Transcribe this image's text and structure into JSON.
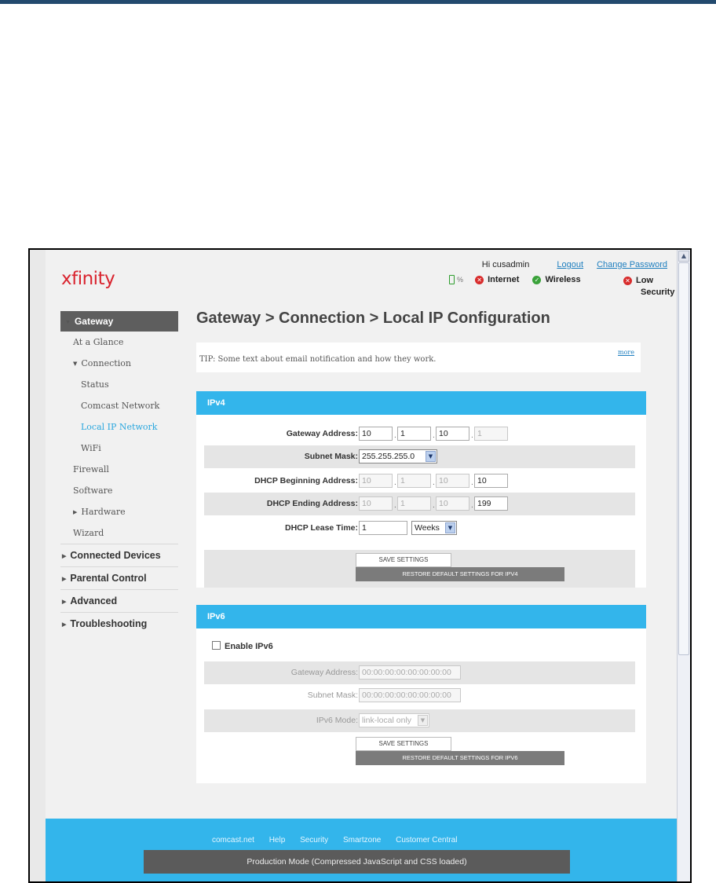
{
  "header": {
    "logo": "xfinity",
    "greeting": "Hi cusadmin",
    "logout": "Logout",
    "change_password": "Change Password",
    "battery_pct": "%",
    "status": {
      "internet": "Internet",
      "wireless": "Wireless",
      "security_1": "Low",
      "security_2": "Security"
    }
  },
  "nav": {
    "gateway": "Gateway",
    "at_a_glance": "At a Glance",
    "connection": "Connection",
    "status": "Status",
    "comcast_network": "Comcast Network",
    "local_ip_network": "Local IP Network",
    "wifi": "WiFi",
    "firewall": "Firewall",
    "software": "Software",
    "hardware": "Hardware",
    "wizard": "Wizard",
    "connected_devices": "Connected Devices",
    "parental_control": "Parental Control",
    "advanced": "Advanced",
    "troubleshooting": "Troubleshooting"
  },
  "main": {
    "title": "Gateway > Connection > Local IP Configuration",
    "tip": "TIP: Some text about email notification and how they work.",
    "more": "more"
  },
  "ipv4": {
    "heading": "IPv4",
    "gateway_label": "Gateway Address:",
    "gateway": [
      "10",
      "1",
      "10",
      "1"
    ],
    "subnet_label": "Subnet Mask:",
    "subnet_value": "255.255.255.0",
    "dhcp_begin_label": "DHCP Beginning Address:",
    "dhcp_begin": [
      "10",
      "1",
      "10",
      "10"
    ],
    "dhcp_end_label": "DHCP Ending Address:",
    "dhcp_end": [
      "10",
      "1",
      "10",
      "199"
    ],
    "lease_label": "DHCP Lease Time:",
    "lease_value": "1",
    "lease_unit": "Weeks",
    "save": "SAVE SETTINGS",
    "restore": "RESTORE DEFAULT SETTINGS FOR IPV4"
  },
  "ipv6": {
    "heading": "IPv6",
    "enable_label": "Enable IPv6",
    "gateway_label": "Gateway Address:",
    "gateway_value": "00:00:00:00:00:00:00:00",
    "subnet_label": "Subnet Mask:",
    "subnet_value": "00:00:00:00:00:00:00:00",
    "mode_label": "IPv6 Mode:",
    "mode_value": "link-local only",
    "save": "SAVE SETTINGS",
    "restore": "RESTORE DEFAULT SETTINGS FOR IPV6"
  },
  "footer": {
    "links": [
      "comcast.net",
      "Help",
      "Security",
      "Smartzone",
      "Customer Central"
    ],
    "production": "Production Mode (Compressed JavaScript and CSS loaded)"
  }
}
